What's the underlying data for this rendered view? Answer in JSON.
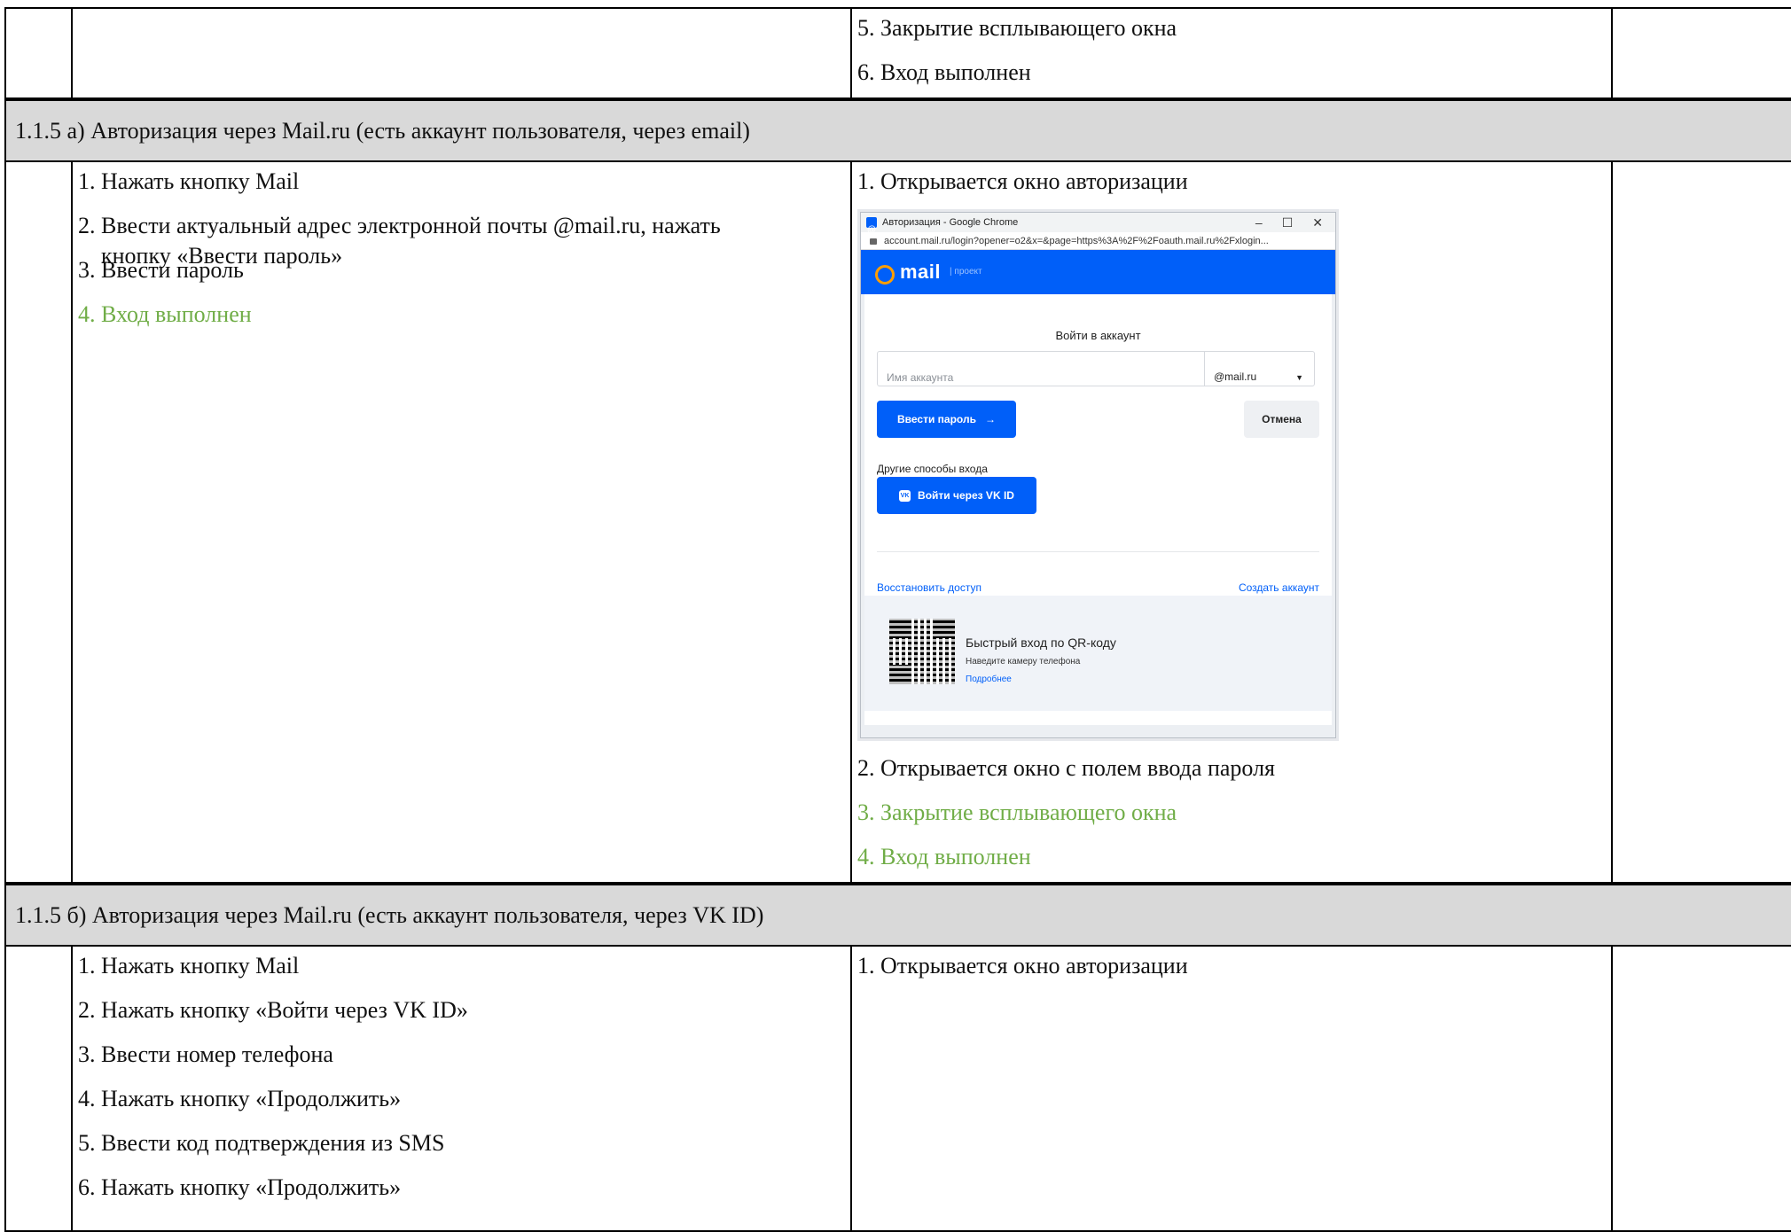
{
  "top_section": {
    "expected": [
      "5. Закрытие всплывающего окна",
      "6. Вход выполнен"
    ]
  },
  "section_a": {
    "title": "1.1.5 а) Авторизация через Mail.ru (есть аккаунт пользователя, через email)",
    "steps": [
      "1. Нажать кнопку Mail",
      "2. Ввести актуальный адрес электронной почты @mail.ru, нажать",
      "кнопку «Ввести пароль»",
      "3. Ввести пароль",
      "4. Вход выполнен"
    ],
    "expected": [
      "1. Открывается окно авторизации",
      "2. Открывается окно с полем ввода пароля",
      "3. Закрытие всплывающего окна",
      "4. Вход выполнен"
    ]
  },
  "screenshot": {
    "window_title": "Авторизация - Google Chrome",
    "url": "account.mail.ru/login?opener=o2&x=&page=https%3A%2F%2Foauth.mail.ru%2Fxlogin...",
    "logo": "mail",
    "logo_sub": "| проект",
    "heading": "Войти в аккаунт",
    "account_placeholder": "Имя аккаунта",
    "domain_value": "@mail.ru",
    "enter_password_label": "Ввести пароль",
    "cancel_label": "Отмена",
    "other_methods": "Другие способы входа",
    "vk_label": "Войти через VK ID",
    "vk_badge": "VK",
    "restore_label": "Восстановить доступ",
    "create_label": "Создать аккаунт",
    "qr_title": "Быстрый вход по QR-коду",
    "qr_subtitle": "Наведите камеру телефона",
    "qr_more": "Подробнее"
  },
  "section_b": {
    "title": "1.1.5 б) Авторизация через Mail.ru (есть аккаунт пользователя, через VK ID)",
    "steps": [
      "1. Нажать кнопку Mail",
      "2. Нажать кнопку «Войти через VK ID»",
      "3. Ввести номер телефона",
      "4. Нажать кнопку «Продолжить»",
      "5. Ввести код подтверждения из SMS",
      "6. Нажать кнопку «Продолжить»"
    ],
    "expected": [
      "1. Открывается окно авторизации"
    ]
  },
  "colors": {
    "success_text": "#70ad47",
    "section_bg": "#d9d9d9",
    "mail_blue": "#005ff9"
  }
}
